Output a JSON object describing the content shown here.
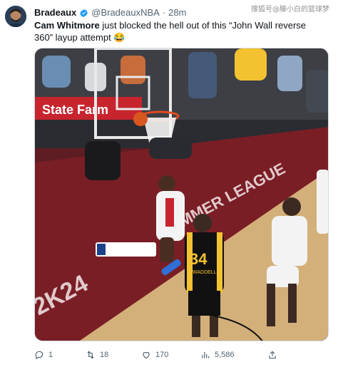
{
  "watermark": "搜狐号@滕小白的篮球梦",
  "tweet": {
    "author_name": "Bradeaux",
    "author_handle": "@BradeauxNBA",
    "separator": "·",
    "time": "28m",
    "text_bold": "Cam Whitmore",
    "text_rest": " just blocked the hell out of this “John Wall reverse 360” layup attempt 😂",
    "verified_color": "#1d9bf0",
    "media": {
      "banner_text": "State Farm",
      "court_text": "SUMMER LEAGUE",
      "floor_text": "2K24",
      "jersey_number": "34",
      "jersey_name": "WADDELL"
    },
    "metrics": {
      "replies": "1",
      "reposts": "18",
      "likes": "170",
      "views": "5,586"
    }
  }
}
